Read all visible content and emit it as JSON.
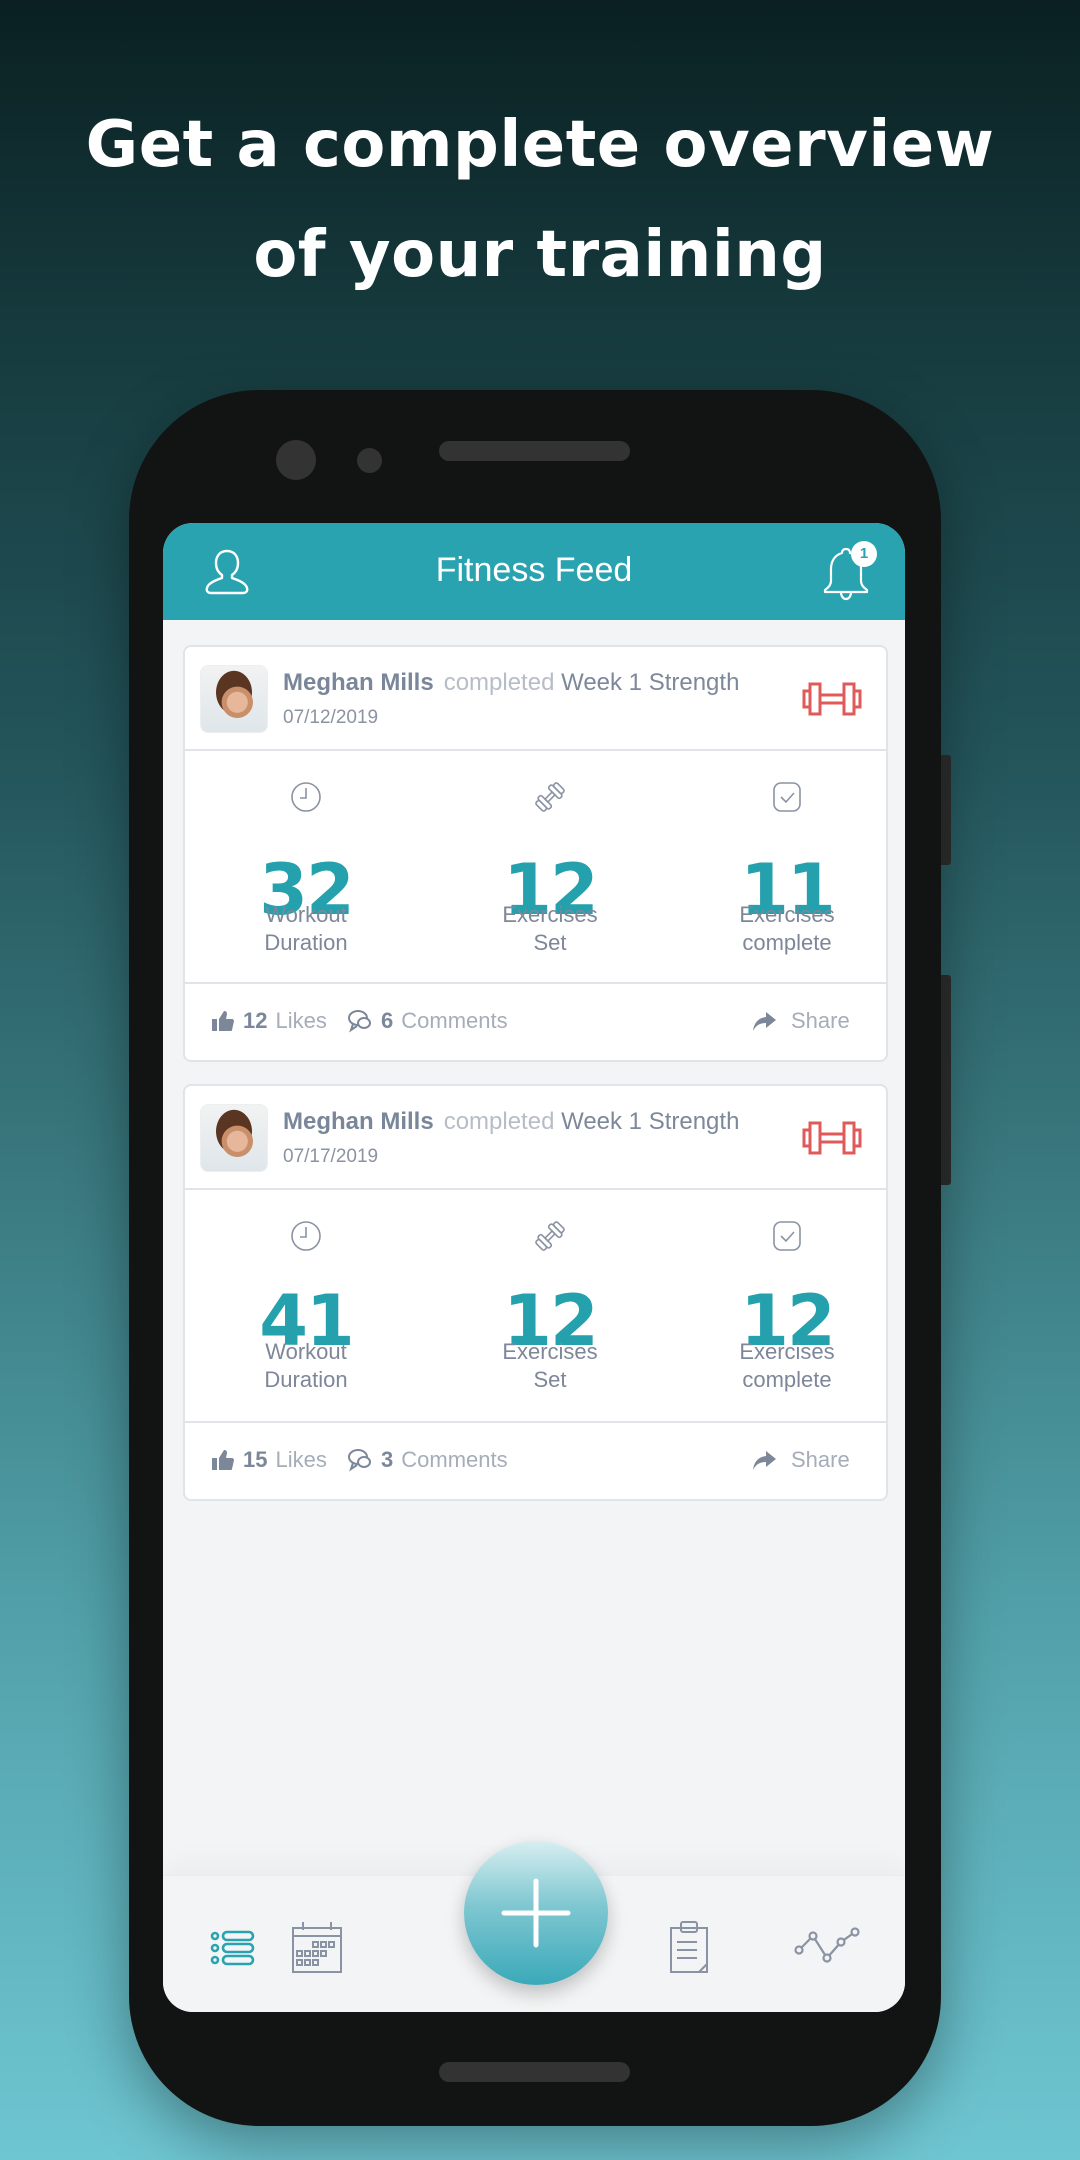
{
  "promo": {
    "headline_line1": "Get a complete overview",
    "headline_line2": "of your training"
  },
  "app": {
    "title": "Fitness Feed",
    "notification_count": "1",
    "accent_color": "#2aa3b1",
    "workout_type_color": "#e05a5a"
  },
  "feed": [
    {
      "user": "Meghan Mills",
      "verb": "completed",
      "workout": "Week 1 Strength",
      "date": "07/12/2019",
      "workout_type_icon": "dumbbell-icon",
      "stats": [
        {
          "icon": "clock-icon",
          "value": "32",
          "label_line1": "Workout",
          "label_line2": "Duration"
        },
        {
          "icon": "dumbbell-icon",
          "value": "12",
          "label_line1": "Exercises",
          "label_line2": "Set"
        },
        {
          "icon": "checkbox-icon",
          "value": "11",
          "label_line1": "Exercises",
          "label_line2": "complete"
        }
      ],
      "likes_count": "12",
      "likes_label": "Likes",
      "comments_count": "6",
      "comments_label": "Comments",
      "share_label": "Share"
    },
    {
      "user": "Meghan Mills",
      "verb": "completed",
      "workout": "Week 1 Strength",
      "date": "07/17/2019",
      "workout_type_icon": "dumbbell-icon",
      "stats": [
        {
          "icon": "clock-icon",
          "value": "41",
          "label_line1": "Workout",
          "label_line2": "Duration"
        },
        {
          "icon": "dumbbell-icon",
          "value": "12",
          "label_line1": "Exercises",
          "label_line2": "Set"
        },
        {
          "icon": "checkbox-icon",
          "value": "12",
          "label_line1": "Exercises",
          "label_line2": "complete"
        }
      ],
      "likes_count": "15",
      "likes_label": "Likes",
      "comments_count": "3",
      "comments_label": "Comments",
      "share_label": "Share"
    }
  ],
  "tabbar": {
    "items": [
      {
        "name": "feed",
        "icon": "list-icon",
        "active": true
      },
      {
        "name": "calendar",
        "icon": "calendar-icon",
        "active": false
      },
      {
        "name": "add",
        "icon": "plus-icon",
        "active": false
      },
      {
        "name": "plans",
        "icon": "clipboard-icon",
        "active": false
      },
      {
        "name": "progress",
        "icon": "line-chart-icon",
        "active": false
      }
    ]
  }
}
